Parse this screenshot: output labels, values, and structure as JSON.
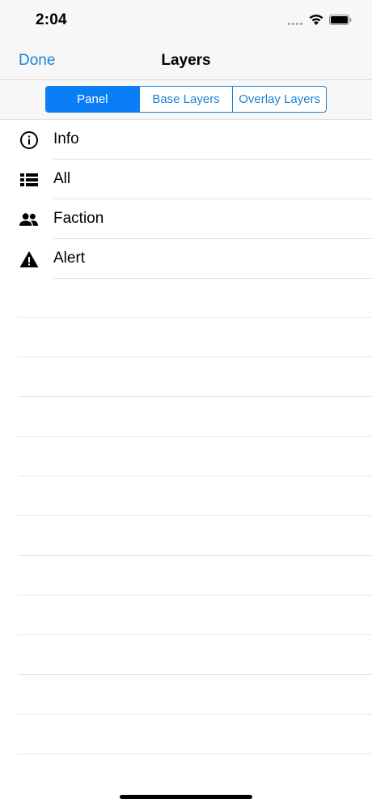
{
  "status_bar": {
    "time": "2:04"
  },
  "nav": {
    "done_label": "Done",
    "title": "Layers"
  },
  "segments": [
    {
      "label": "Panel",
      "selected": true
    },
    {
      "label": "Base Layers",
      "selected": false
    },
    {
      "label": "Overlay Layers",
      "selected": false
    }
  ],
  "list": {
    "items": [
      {
        "label": "Info",
        "icon": "info-icon"
      },
      {
        "label": "All",
        "icon": "list-icon"
      },
      {
        "label": "Faction",
        "icon": "people-icon"
      },
      {
        "label": "Alert",
        "icon": "warning-icon"
      }
    ]
  },
  "colors": {
    "accent": "#1a82d6",
    "selected_segment": "#0a7ef7",
    "bar_background": "#f7f7f7"
  }
}
